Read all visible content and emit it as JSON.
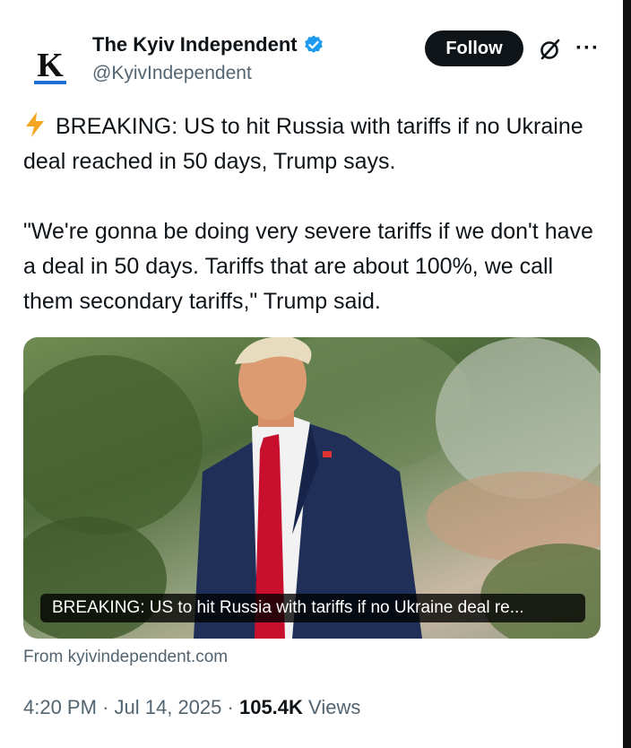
{
  "account": {
    "avatar_letter": "K",
    "name": "The Kyiv Independent",
    "handle": "@KyivIndependent",
    "verified_icon": "verified-badge-icon"
  },
  "actions": {
    "follow_label": "Follow",
    "grok_icon": "grok-icon",
    "more_label": "···"
  },
  "tweet": {
    "line1": "BREAKING: US to hit Russia with tariffs if no Ukraine deal reached in 50 days, Trump says.",
    "line2": "\"We're gonna be doing very severe tariffs if we don't have a deal in 50 days. Tariffs that are about 100%, we call them secondary tariffs,\" Trump said.",
    "emoji_icon": "lightning-bolt-icon"
  },
  "card": {
    "caption": "BREAKING: US to hit Russia with tariffs if no Ukraine deal re...",
    "source": "From kyivindependent.com"
  },
  "meta": {
    "time": "4:20 PM",
    "date": "Jul 14, 2025",
    "separator": "·",
    "views_count": "105.4K",
    "views_label": "Views"
  },
  "colors": {
    "accent": "#1d9bf0",
    "text": "#0f1419",
    "secondary": "#536471",
    "tie": "#c8102e",
    "suit": "#1f2f57"
  }
}
